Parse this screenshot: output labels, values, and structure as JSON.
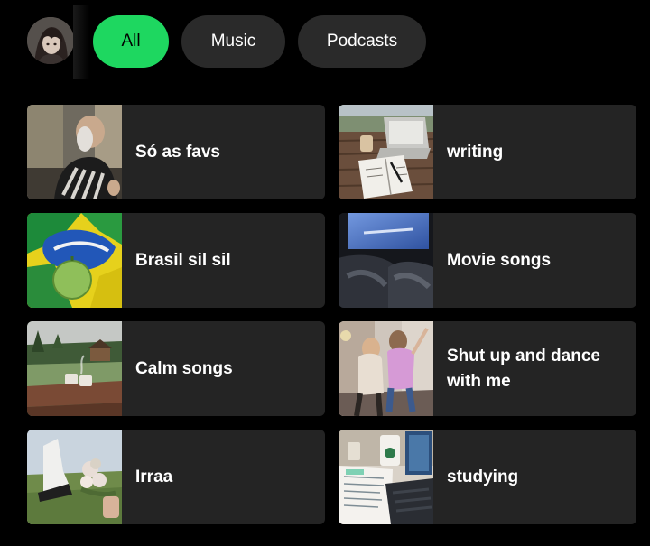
{
  "filters": {
    "chips": [
      {
        "label": "All",
        "active": true
      },
      {
        "label": "Music",
        "active": false
      },
      {
        "label": "Podcasts",
        "active": false
      }
    ]
  },
  "theme": {
    "accent": "#1ed760",
    "background": "#000000",
    "chip_bg": "#2a2a2a",
    "card_bg": "#242424"
  },
  "shortcuts": [
    {
      "title": "Só as favs"
    },
    {
      "title": "writing"
    },
    {
      "title": "Brasil sil sil"
    },
    {
      "title": "Movie songs"
    },
    {
      "title": "Calm songs"
    },
    {
      "title": "Shut up and dance with me"
    },
    {
      "title": "Irraa"
    },
    {
      "title": "studying"
    }
  ]
}
